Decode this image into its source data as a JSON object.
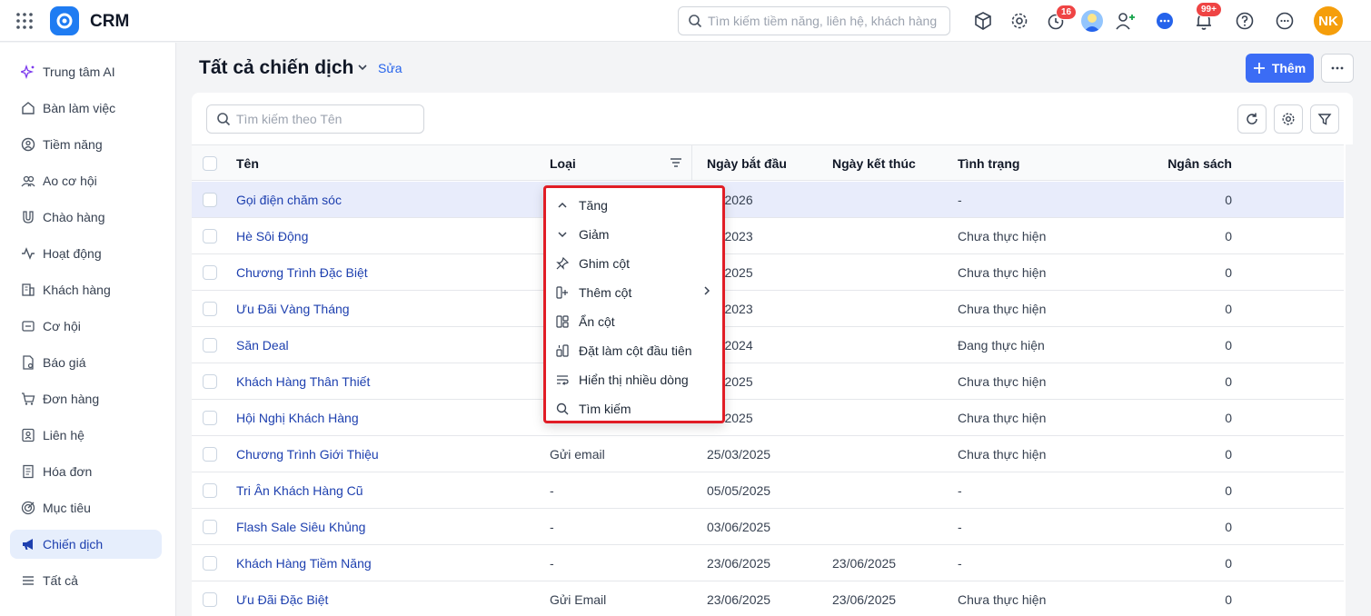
{
  "app": {
    "title": "CRM"
  },
  "topbar": {
    "search_placeholder": "Tìm kiếm tiềm năng, liên hệ, khách hàng",
    "timer_badge": "16",
    "notif_badge": "99+",
    "user_initials": "NK",
    "accent_color": "#f59e0b"
  },
  "sidebar": {
    "items": [
      {
        "label": "Trung tâm AI",
        "icon": "sparkle-icon"
      },
      {
        "label": "Bàn làm việc",
        "icon": "home-icon"
      },
      {
        "label": "Tiềm năng",
        "icon": "target-user-icon"
      },
      {
        "label": "Ao cơ hội",
        "icon": "users-icon"
      },
      {
        "label": "Chào hàng",
        "icon": "magnet-icon"
      },
      {
        "label": "Hoạt động",
        "icon": "activity-icon"
      },
      {
        "label": "Khách hàng",
        "icon": "building-icon"
      },
      {
        "label": "Cơ hội",
        "icon": "folder-icon"
      },
      {
        "label": "Báo giá",
        "icon": "quote-doc-icon"
      },
      {
        "label": "Đơn hàng",
        "icon": "cart-icon"
      },
      {
        "label": "Liên hệ",
        "icon": "contact-icon"
      },
      {
        "label": "Hóa đơn",
        "icon": "invoice-icon"
      },
      {
        "label": "Mục tiêu",
        "icon": "goal-icon"
      },
      {
        "label": "Chiến dịch",
        "icon": "megaphone-icon"
      },
      {
        "label": "Tất cả",
        "icon": "menu-icon"
      }
    ],
    "active_index": 13
  },
  "page": {
    "title": "Tất cả chiến dịch",
    "edit_label": "Sửa",
    "add_label": "Thêm",
    "table_search_placeholder": "Tìm kiếm theo Tên"
  },
  "table": {
    "columns": [
      "Tên",
      "Loại",
      "Ngày bắt đầu",
      "Ngày kết thúc",
      "Tình trạng",
      "Ngân sách"
    ],
    "rows": [
      {
        "name": "Gọi điện chăm sóc",
        "type": "",
        "start": "01/2026",
        "end": "",
        "status": "-",
        "budget": "0"
      },
      {
        "name": "Hè Sôi Động",
        "type": "",
        "start": "12/2023",
        "end": "",
        "status": "Chưa thực hiện",
        "budget": "0"
      },
      {
        "name": "Chương Trình Đặc Biệt",
        "type": "",
        "start": "12/2025",
        "end": "",
        "status": "Chưa thực hiện",
        "budget": "0"
      },
      {
        "name": "Ưu Đãi Vàng Tháng",
        "type": "",
        "start": "12/2023",
        "end": "",
        "status": "Chưa thực hiện",
        "budget": "0"
      },
      {
        "name": "Săn Deal",
        "type": "",
        "start": "08/2024",
        "end": "",
        "status": "Đang thực hiện",
        "budget": "0"
      },
      {
        "name": "Khách Hàng Thân Thiết",
        "type": "",
        "start": "03/2025",
        "end": "",
        "status": "Chưa thực hiện",
        "budget": "0"
      },
      {
        "name": "Hội Nghị Khách Hàng",
        "type": "",
        "start": "03/2025",
        "end": "",
        "status": "Chưa thực hiện",
        "budget": "0"
      },
      {
        "name": "Chương Trình Giới Thiệu",
        "type": "Gửi email",
        "start": "25/03/2025",
        "end": "",
        "status": "Chưa thực hiện",
        "budget": "0"
      },
      {
        "name": "Tri Ân Khách Hàng Cũ",
        "type": "-",
        "start": "05/05/2025",
        "end": "",
        "status": "-",
        "budget": "0"
      },
      {
        "name": "Flash Sale Siêu Khủng",
        "type": "-",
        "start": "03/06/2025",
        "end": "",
        "status": "-",
        "budget": "0"
      },
      {
        "name": "Khách Hàng Tiềm Năng",
        "type": "-",
        "start": "23/06/2025",
        "end": "23/06/2025",
        "status": "-",
        "budget": "0"
      },
      {
        "name": "Ưu Đãi Đặc Biệt",
        "type": "Gửi Email",
        "start": "23/06/2025",
        "end": "23/06/2025",
        "status": "Chưa thực hiện",
        "budget": "0"
      }
    ]
  },
  "column_menu": {
    "items": [
      {
        "label": "Tăng",
        "icon": "chevron-up-icon"
      },
      {
        "label": "Giảm",
        "icon": "chevron-down-icon"
      },
      {
        "label": "Ghim cột",
        "icon": "pin-icon"
      },
      {
        "label": "Thêm cột",
        "icon": "add-column-icon"
      },
      {
        "label": "Ẩn cột",
        "icon": "hide-column-icon"
      },
      {
        "label": "Đặt làm cột đầu tiên",
        "icon": "first-column-icon"
      },
      {
        "label": "Hiển thị nhiều dòng",
        "icon": "wrap-lines-icon"
      },
      {
        "label": "Tìm kiếm",
        "icon": "search-icon"
      }
    ]
  }
}
